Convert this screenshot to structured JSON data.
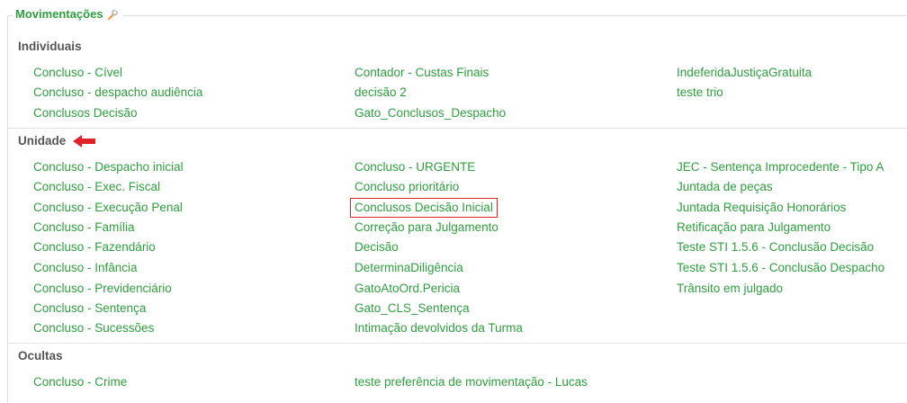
{
  "fieldset": {
    "legend": "Movimentações",
    "legend_icon": "wrench-icon"
  },
  "sections": {
    "individuais": {
      "title": "Individuais",
      "col1": [
        "Concluso - Cível",
        "Concluso - despacho audiência",
        "Conclusos Decisão"
      ],
      "col2": [
        "Contador - Custas Finais",
        "decisão 2",
        "Gato_Conclusos_Despacho"
      ],
      "col3": [
        "IndeferidaJustiçaGratuita",
        "teste trio"
      ]
    },
    "unidade": {
      "title": "Unidade",
      "arrow_icon": "left-arrow-icon",
      "col1": [
        "Concluso - Despacho inicial",
        "Concluso - Exec. Fiscal",
        "Concluso - Execução Penal",
        "Concluso - Família",
        "Concluso - Fazendário",
        "Concluso - Infância",
        "Concluso - Previdenciário",
        "Concluso - Sentença",
        "Concluso - Sucessões"
      ],
      "col2": [
        "Concluso - URGENTE",
        "Concluso prioritário",
        "Conclusos Decisão Inicial",
        "Correção para Julgamento",
        "Decisão",
        "DeterminaDiligência",
        "GatoAtoOrd.Pericia",
        "Gato_CLS_Sentença",
        "Intimação devolvidos da Turma"
      ],
      "col3": [
        "JEC - Sentença Improcedente - Tipo A",
        "Juntada de peças",
        "Juntada Requisição Honorários",
        "Retificação para Julgamento",
        "Teste STI 1.5.6 - Conclusão Decisão",
        "Teste STI 1.5.6 - Conclusão Despacho",
        "Trânsito em julgado"
      ]
    },
    "ocultas": {
      "title": "Ocultas",
      "col1": [
        "Concluso - Crime"
      ],
      "col2": [
        "teste preferência de movimentação - Lucas"
      ]
    }
  },
  "colors": {
    "link": "#2e9e3e",
    "highlight_box": "#e0232a",
    "arrow": "#e0232a"
  }
}
